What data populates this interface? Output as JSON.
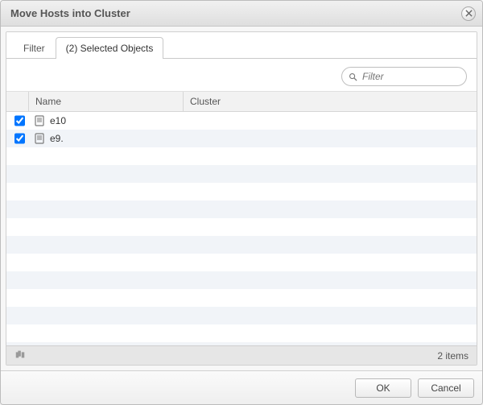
{
  "dialog": {
    "title": "Move Hosts into Cluster"
  },
  "tabs": {
    "filter": "Filter",
    "selected": "(2) Selected Objects"
  },
  "filter": {
    "placeholder": "Filter"
  },
  "columns": {
    "name": "Name",
    "cluster": "Cluster"
  },
  "rows": [
    {
      "checked": true,
      "name": "e10",
      "cluster": ""
    },
    {
      "checked": true,
      "name": "e9.",
      "cluster": ""
    }
  ],
  "status": {
    "count_text": "2 items"
  },
  "buttons": {
    "ok": "OK",
    "cancel": "Cancel"
  }
}
